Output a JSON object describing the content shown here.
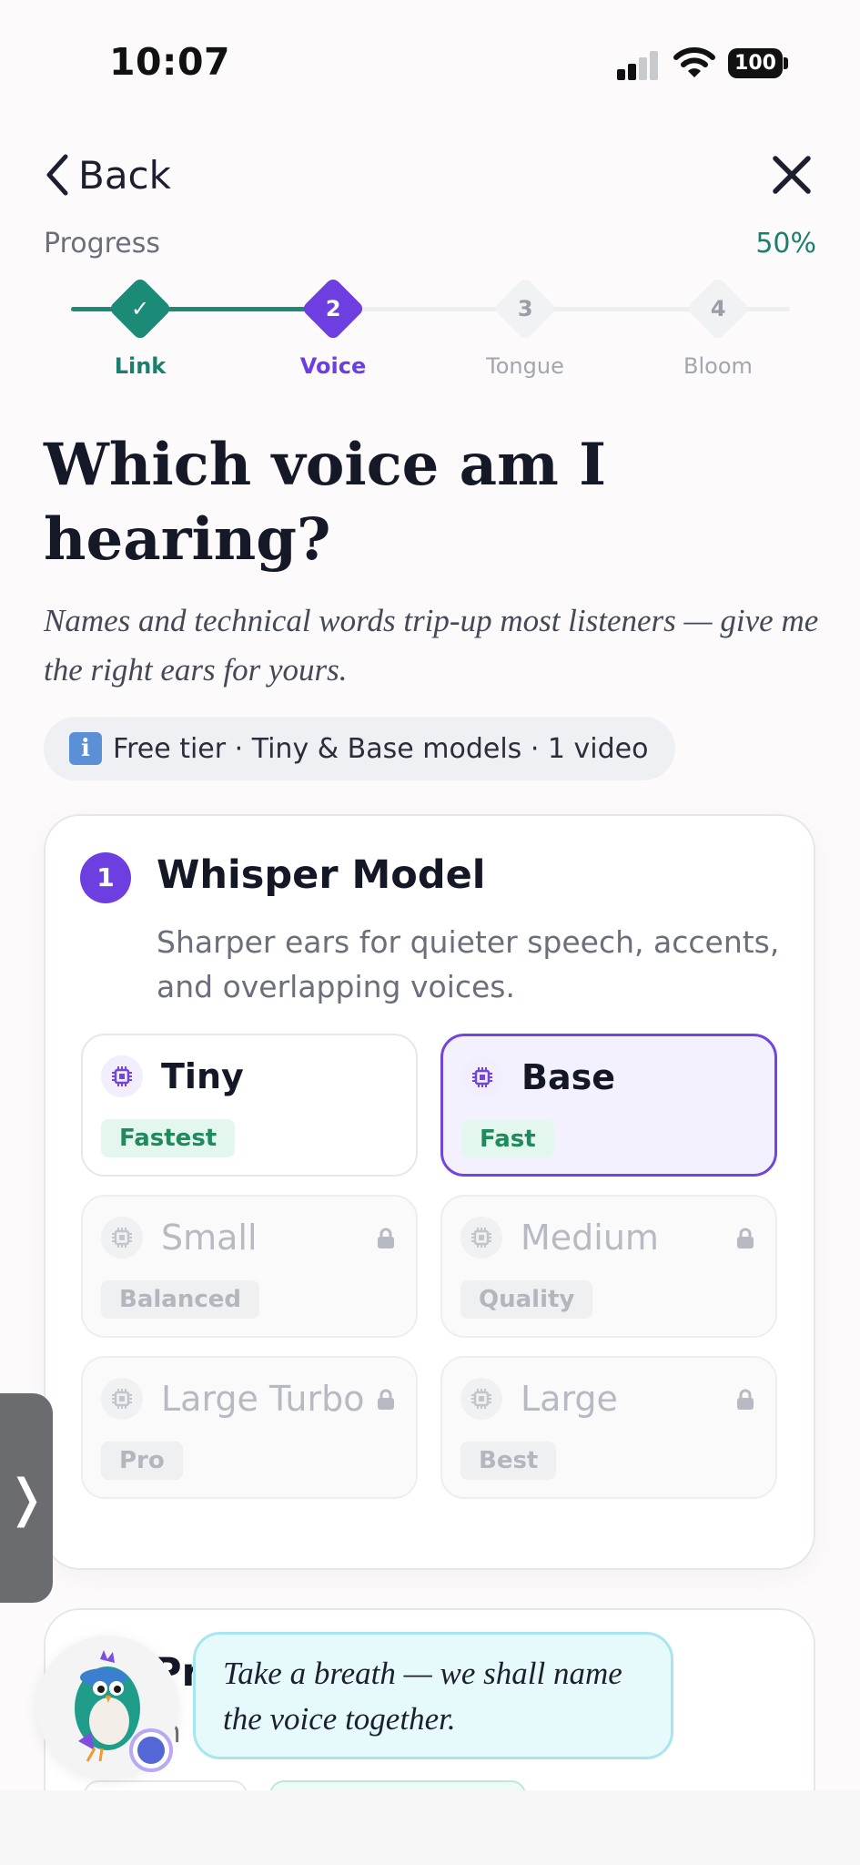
{
  "status_bar": {
    "time": "10:07",
    "battery": "100"
  },
  "header": {
    "back_label": "Back"
  },
  "progress": {
    "label": "Progress",
    "percent_text": "50%",
    "value": 0.5,
    "steps": [
      {
        "marker": "✓",
        "label": "Link",
        "state": "done"
      },
      {
        "marker": "2",
        "label": "Voice",
        "state": "current"
      },
      {
        "marker": "3",
        "label": "Tongue",
        "state": "upcoming"
      },
      {
        "marker": "4",
        "label": "Bloom",
        "state": "upcoming"
      }
    ]
  },
  "page": {
    "title": "Which voice am I hearing?",
    "subtitle": "Names and technical words trip-up most listeners — give me the right ears for yours.",
    "tier_note": "Free tier · Tiny & Base models · 1 video"
  },
  "model_section": {
    "number": "1",
    "title": "Whisper Model",
    "description": "Sharper ears for quieter speech, accents, and overlapping voices.",
    "options": [
      {
        "name": "Tiny",
        "badge": "Fastest",
        "locked": false,
        "selected": false
      },
      {
        "name": "Base",
        "badge": "Fast",
        "locked": false,
        "selected": true
      },
      {
        "name": "Small",
        "badge": "Balanced",
        "locked": true,
        "selected": false
      },
      {
        "name": "Medium",
        "badge": "Quality",
        "locked": true,
        "selected": false
      },
      {
        "name": "Large Turbo",
        "badge": "Pro",
        "locked": true,
        "selected": false
      },
      {
        "name": "Large",
        "badge": "Best",
        "locked": true,
        "selected": false
      }
    ]
  },
  "side_handle": {
    "glyph": "❭"
  },
  "next_section": {
    "title_fragment": "Pr",
    "desc_fragment_start": "h",
    "desc_fragment_end": "o"
  },
  "assistant": {
    "message": "Take a breath — we shall name the voice together."
  },
  "colors": {
    "accent_purple": "#6d3fe0",
    "accent_green": "#1b8a76",
    "bubble_bg": "#e6fafc"
  }
}
